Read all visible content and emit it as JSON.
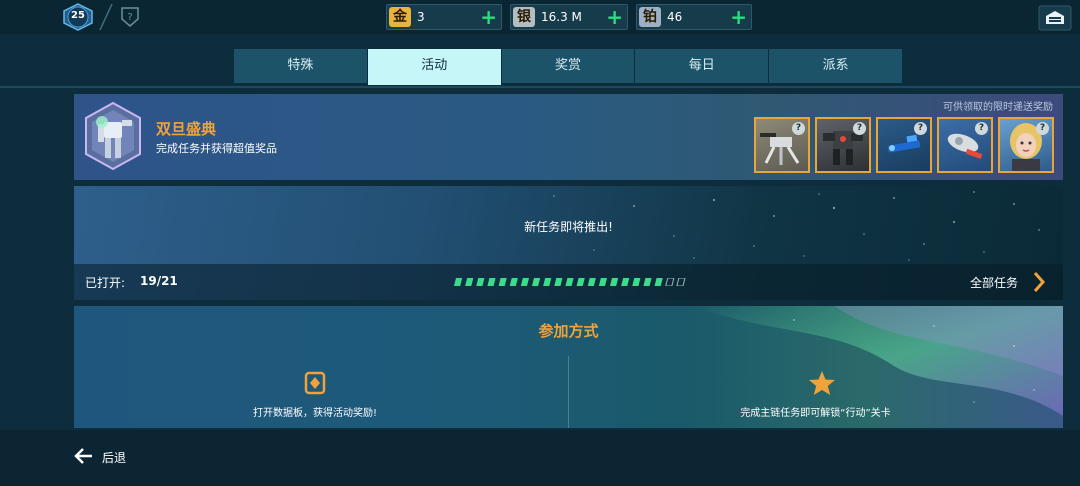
{
  "player": {
    "level": "25"
  },
  "currencies": [
    {
      "icon_char": "金",
      "value": "3",
      "color": "#e8b43a"
    },
    {
      "icon_char": "银",
      "value": "16.3 M",
      "color": "#b4bcc4"
    },
    {
      "icon_char": "铂",
      "value": "46",
      "color": "#9db0c8"
    }
  ],
  "currency_add_label": "+",
  "tabs": [
    "特殊",
    "活动",
    "奖赏",
    "每日",
    "派系"
  ],
  "active_tab": "活动",
  "event": {
    "title": "双旦盛典",
    "description": "完成任务并获得超值奖品",
    "rewards_label": "可供领取的限时递送奖励",
    "rewards": [
      {
        "icon": "walker-robot-icon",
        "mark": "?"
      },
      {
        "icon": "heavy-robot-icon",
        "mark": "?"
      },
      {
        "icon": "blue-weapon-icon",
        "mark": "?"
      },
      {
        "icon": "cannon-weapon-icon",
        "mark": "?"
      },
      {
        "icon": "pilot-portrait-icon",
        "mark": "?"
      }
    ]
  },
  "missions": {
    "coming_soon": "新任务即将推出!",
    "opened_label": "已打开:",
    "opened_value": "19/21",
    "progress": {
      "opened": 19,
      "total": 21
    },
    "all_missions_label": "全部任务"
  },
  "join": {
    "title": "参加方式",
    "left_text": "打开数据板，获得活动奖励!",
    "right_text": "完成主链任务即可解锁“行动”关卡"
  },
  "back_label": "后退",
  "colors": {
    "accent_orange": "#f1a23a",
    "plus_green": "#27e07c",
    "progress_green": "#3ddc8a",
    "tab_active": "#c7f6f8"
  }
}
